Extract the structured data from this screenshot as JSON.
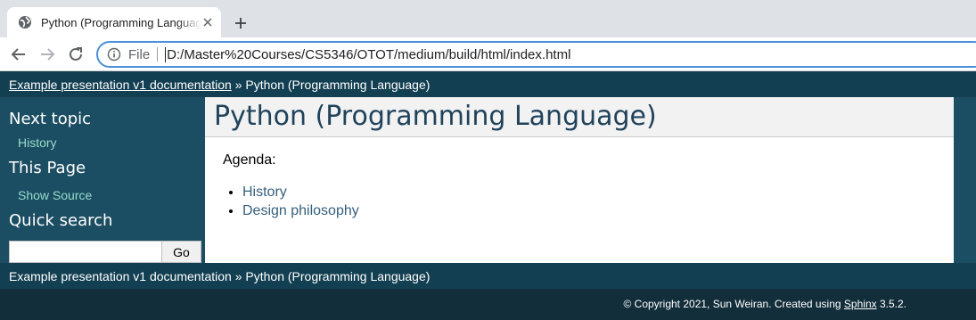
{
  "browser": {
    "tab_title": "Python (Programming Language)",
    "address_scheme": "File",
    "address_url": "D:/Master%20Courses/CS5346/OTOT/medium/build/html/index.html",
    "icons": [
      "globe-icon",
      "close-icon",
      "plus-icon",
      "back-arrow-icon",
      "forward-arrow-icon",
      "reload-icon",
      "info-icon"
    ]
  },
  "related": {
    "home_link": "Example presentation v1 documentation",
    "separator": "»",
    "current": "Python (Programming Language)"
  },
  "sidebar": {
    "next_topic_heading": "Next topic",
    "next_topic_link": "History",
    "this_page_heading": "This Page",
    "show_source_link": "Show Source",
    "quick_search_heading": "Quick search",
    "search_value": "",
    "go_label": "Go"
  },
  "main": {
    "title": "Python (Programming Language)",
    "agenda_label": "Agenda:",
    "agenda_items": [
      "History",
      "Design philosophy"
    ]
  },
  "footer": {
    "copyright": "© Copyright 2021, Sun Weiran. Created using",
    "sphinx_link": "Sphinx",
    "version": "3.5.2."
  },
  "colors": {
    "header_bar": "#133f52",
    "sidebar_bg": "#1c4e63",
    "footer_bg": "#132e3b",
    "sidebar_link": "#98dbcc",
    "content_link": "#355f7c",
    "title_text": "#20435c"
  }
}
